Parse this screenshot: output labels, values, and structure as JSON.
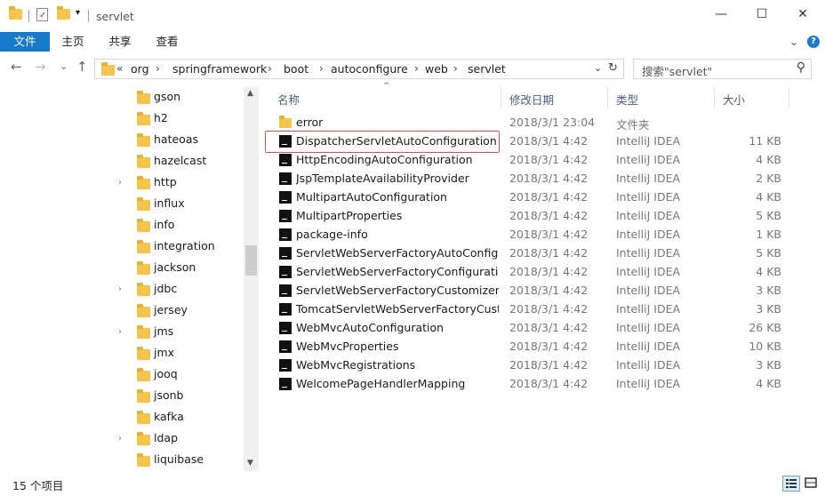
{
  "window": {
    "title": "servlet",
    "minimize": "—",
    "maximize": "☐",
    "close": "✕"
  },
  "ribbon": {
    "tabs": [
      "文件",
      "主页",
      "共享",
      "查看"
    ],
    "expand": "⌄",
    "help": "?"
  },
  "address": {
    "back": "←",
    "forward": "→",
    "recent": "⌄",
    "up": "↑",
    "overflow": "«",
    "crumbs": [
      "org",
      "springframework",
      "boot",
      "autoconfigure",
      "web",
      "servlet"
    ],
    "dropdown": "⌄",
    "refresh": "↻",
    "search_placeholder": "搜索\"servlet\"",
    "search_icon": "⚲"
  },
  "nav": {
    "items": [
      {
        "label": "gson",
        "expandable": false
      },
      {
        "label": "h2",
        "expandable": false
      },
      {
        "label": "hateoas",
        "expandable": false
      },
      {
        "label": "hazelcast",
        "expandable": false
      },
      {
        "label": "http",
        "expandable": true
      },
      {
        "label": "influx",
        "expandable": false
      },
      {
        "label": "info",
        "expandable": false
      },
      {
        "label": "integration",
        "expandable": false
      },
      {
        "label": "jackson",
        "expandable": false
      },
      {
        "label": "jdbc",
        "expandable": true
      },
      {
        "label": "jersey",
        "expandable": false
      },
      {
        "label": "jms",
        "expandable": true
      },
      {
        "label": "jmx",
        "expandable": false
      },
      {
        "label": "jooq",
        "expandable": false
      },
      {
        "label": "jsonb",
        "expandable": false
      },
      {
        "label": "kafka",
        "expandable": false
      },
      {
        "label": "ldap",
        "expandable": true
      },
      {
        "label": "liquibase",
        "expandable": false
      }
    ],
    "expander_glyph": "›"
  },
  "list": {
    "columns": {
      "name": "名称",
      "date": "修改日期",
      "type": "类型",
      "size": "大小"
    },
    "sort_glyph": "^",
    "files": [
      {
        "name": "error",
        "date": "2018/3/1 23:04",
        "type": "文件夹",
        "size": "",
        "icon": "folder-icon"
      },
      {
        "name": "DispatcherServletAutoConfiguration",
        "date": "2018/3/1 4:42",
        "type": "IntelliJ IDEA",
        "size": "11 KB",
        "icon": "intellij-file-icon"
      },
      {
        "name": "HttpEncodingAutoConfiguration",
        "date": "2018/3/1 4:42",
        "type": "IntelliJ IDEA",
        "size": "4 KB",
        "icon": "intellij-file-icon"
      },
      {
        "name": "JspTemplateAvailabilityProvider",
        "date": "2018/3/1 4:42",
        "type": "IntelliJ IDEA",
        "size": "2 KB",
        "icon": "intellij-file-icon"
      },
      {
        "name": "MultipartAutoConfiguration",
        "date": "2018/3/1 4:42",
        "type": "IntelliJ IDEA",
        "size": "4 KB",
        "icon": "intellij-file-icon"
      },
      {
        "name": "MultipartProperties",
        "date": "2018/3/1 4:42",
        "type": "IntelliJ IDEA",
        "size": "5 KB",
        "icon": "intellij-file-icon"
      },
      {
        "name": "package-info",
        "date": "2018/3/1 4:42",
        "type": "IntelliJ IDEA",
        "size": "1 KB",
        "icon": "intellij-file-icon"
      },
      {
        "name": "ServletWebServerFactoryAutoConfigu...",
        "date": "2018/3/1 4:42",
        "type": "IntelliJ IDEA",
        "size": "5 KB",
        "icon": "intellij-file-icon"
      },
      {
        "name": "ServletWebServerFactoryConfiguration",
        "date": "2018/3/1 4:42",
        "type": "IntelliJ IDEA",
        "size": "4 KB",
        "icon": "intellij-file-icon"
      },
      {
        "name": "ServletWebServerFactoryCustomizer",
        "date": "2018/3/1 4:42",
        "type": "IntelliJ IDEA",
        "size": "3 KB",
        "icon": "intellij-file-icon"
      },
      {
        "name": "TomcatServletWebServerFactoryCust...",
        "date": "2018/3/1 4:42",
        "type": "IntelliJ IDEA",
        "size": "3 KB",
        "icon": "intellij-file-icon"
      },
      {
        "name": "WebMvcAutoConfiguration",
        "date": "2018/3/1 4:42",
        "type": "IntelliJ IDEA",
        "size": "26 KB",
        "icon": "intellij-file-icon"
      },
      {
        "name": "WebMvcProperties",
        "date": "2018/3/1 4:42",
        "type": "IntelliJ IDEA",
        "size": "10 KB",
        "icon": "intellij-file-icon"
      },
      {
        "name": "WebMvcRegistrations",
        "date": "2018/3/1 4:42",
        "type": "IntelliJ IDEA",
        "size": "3 KB",
        "icon": "intellij-file-icon"
      },
      {
        "name": "WelcomePageHandlerMapping",
        "date": "2018/3/1 4:42",
        "type": "IntelliJ IDEA",
        "size": "4 KB",
        "icon": "intellij-file-icon"
      }
    ]
  },
  "status": {
    "item_count": "15 个项目"
  },
  "colors": {
    "accent": "#1979ca",
    "highlight_border": "#d9534f",
    "folder": "#f3c54d"
  }
}
